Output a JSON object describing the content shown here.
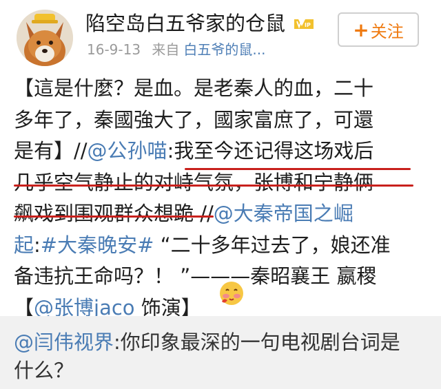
{
  "post": {
    "author": {
      "name": "陷空岛白五爷家的仓鼠",
      "avatar": "fox-avatar",
      "badge": "vip-icon"
    },
    "meta": {
      "date": "16-9-13",
      "source_prefix": "来自",
      "source_name": "白五爷的鼠..."
    },
    "follow_button": {
      "plus": "+",
      "label": "关注",
      "color": "#ef7a10"
    },
    "content": {
      "line1": "【這是什麼？是血。是老秦人的血，二十",
      "line2": "多年了，秦國強大了，國家富庶了，可還",
      "line3_text": "是有】//",
      "line3_mention": "@公孙喵",
      "line3_highlight": ":我至今还记得这场戏后",
      "line4": "几乎空气静止的对峙气氛，张博和宁静俩",
      "line5_highlight": "飙戏到围观群众想跪",
      "line5_sep": " //",
      "line5_mention": "@大秦帝国之崛",
      "line6_mention": "起",
      "line6_colon": ":",
      "line6_topic": "#大秦晚安#",
      "line6_text": " “二十多年过去了，娘还准",
      "line7": "备违抗王命吗？！ ”———秦昭襄王 嬴稷",
      "line8_open": "【",
      "line8_mention": "@张博jaco",
      "line8_text": " 饰演】",
      "emoji": "blushing-face-emoji"
    },
    "colors": {
      "link": "#4a7cb4",
      "underline": "#c8201c"
    }
  },
  "repost": {
    "mention": "@闫伟视界",
    "text_line1": ":你印象最深的一句电视剧台词是",
    "text_line2": "什么？"
  }
}
